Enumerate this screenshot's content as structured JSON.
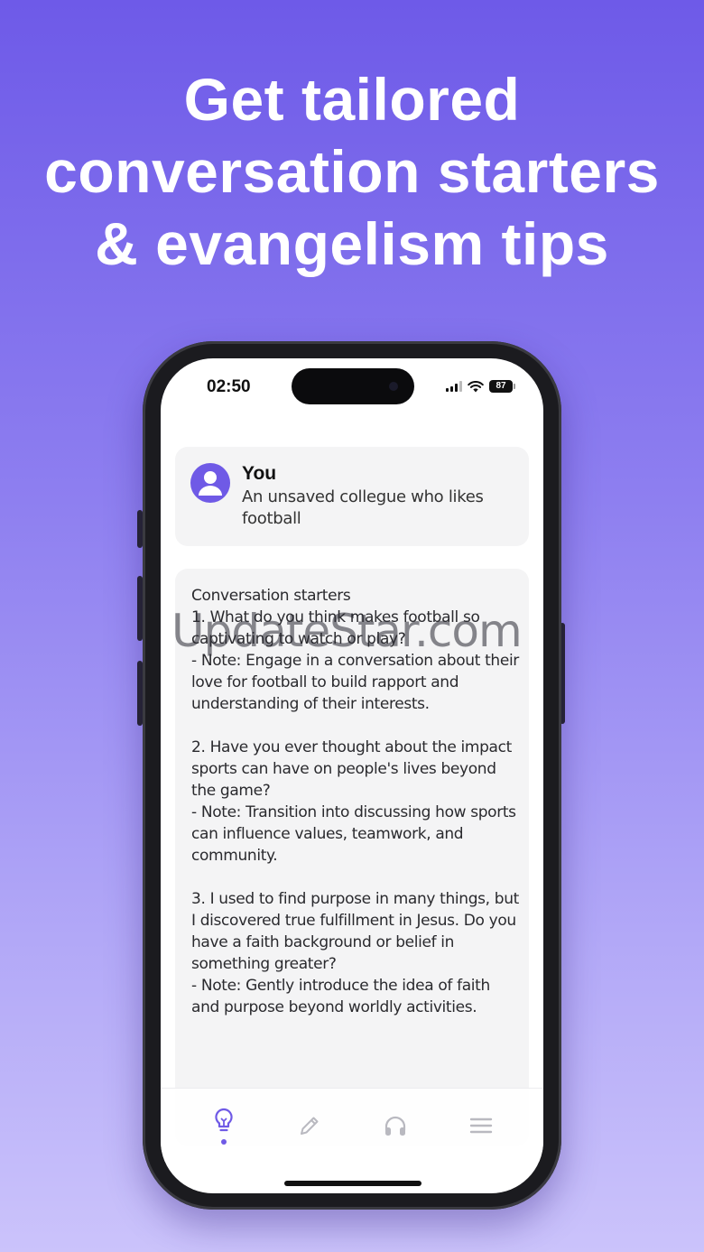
{
  "headline": {
    "line1": "Get tailored",
    "line2": "conversation starters",
    "line3": "& evangelism tips"
  },
  "status_bar": {
    "time": "02:50",
    "battery": "87",
    "icons": [
      "signal-icon",
      "wifi-icon",
      "battery-icon"
    ]
  },
  "you_card": {
    "title": "You",
    "description": "An unsaved collegue who likes football",
    "icon": "user-avatar-icon"
  },
  "starters": {
    "text": "Conversation starters\n1. What do you think makes football so captivating to watch or play?\n- Note: Engage in a conversation about their love for football to build rapport and understanding of their interests.\n\n2. Have you ever thought about the impact sports can have on people's lives beyond the game?\n- Note: Transition into discussing how sports can influence values, teamwork, and community.\n\n3. I used to find purpose in many things, but I discovered true fulfillment in Jesus. Do you have a faith background or belief in something greater?\n- Note: Gently introduce the idea of faith and purpose beyond worldly activities."
  },
  "watermark": "UpdateStar.com",
  "tabbar": {
    "tabs": [
      {
        "icon": "lightbulb-icon",
        "active": true
      },
      {
        "icon": "pencil-icon",
        "active": false
      },
      {
        "icon": "headphones-icon",
        "active": false
      },
      {
        "icon": "menu-icon",
        "active": false
      }
    ]
  },
  "colors": {
    "accent": "#6f5ae6",
    "background_top": "#6e5ae8",
    "background_bottom": "#cbc3fb",
    "card": "#f4f4f5",
    "inactive_icon": "#b9b9c0"
  }
}
